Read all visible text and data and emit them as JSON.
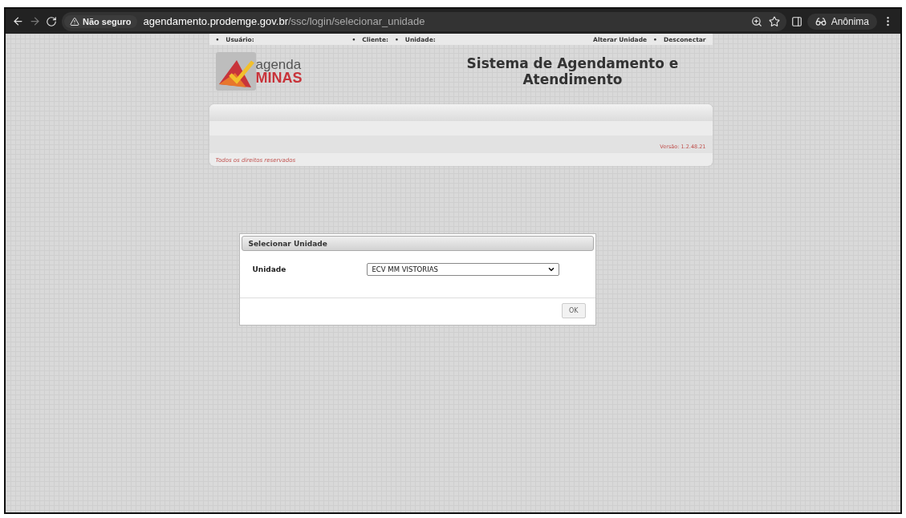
{
  "browser": {
    "security_label": "Não seguro",
    "url_host": "agendamento.prodemge.gov.br",
    "url_path": "/ssc/login/selecionar_unidade",
    "profile": "Anônima"
  },
  "topbar": {
    "left": [
      {
        "bullet": "•",
        "label": "Usuário:"
      }
    ],
    "middle": [
      {
        "bullet": "•",
        "label": "Cliente:"
      },
      {
        "bullet": "•",
        "label": "Unidade:"
      }
    ],
    "links": [
      {
        "label": "Alterar Unidade"
      },
      {
        "bullet": "•",
        "label": "Desconectar"
      }
    ]
  },
  "header": {
    "logo_top": "agenda",
    "logo_bottom": "MINAS",
    "title": "Sistema de Agendamento e Atendimento"
  },
  "panel": {
    "version": "Versão: 1.2.48.21",
    "footer": "Todos os direitos reservados"
  },
  "dialog": {
    "title": "Selecionar Unidade",
    "field_label": "Unidade",
    "field_value": "ECV MM VISTORIAS",
    "button": "OK"
  }
}
